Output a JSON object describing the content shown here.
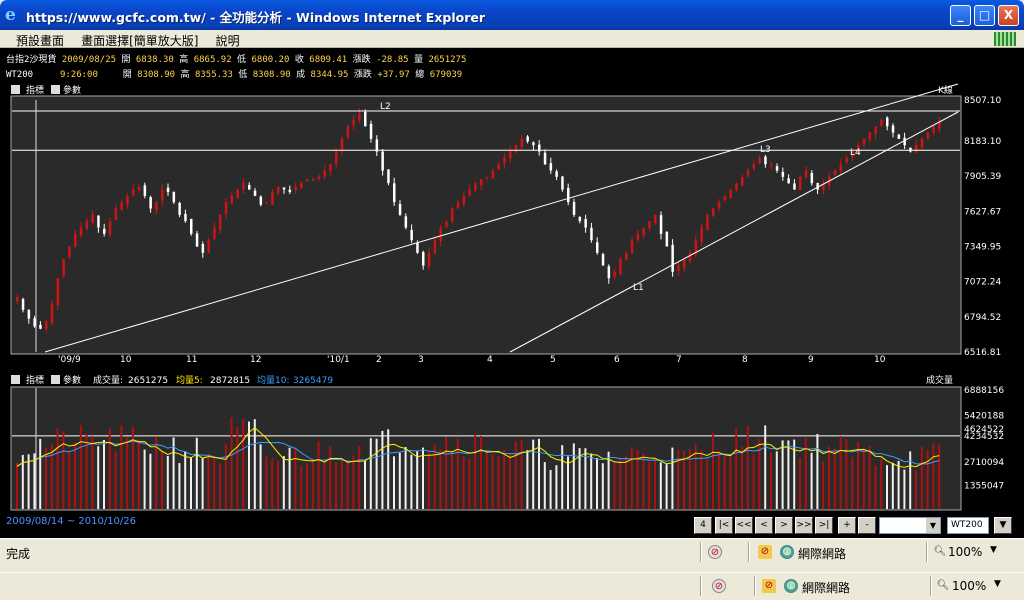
{
  "window": {
    "title": "https://www.gcfc.com.tw/ - 全功能分析 - Windows Internet Explorer",
    "btn_min": "_",
    "btn_max": "□",
    "btn_close": "X"
  },
  "menu": [
    "預設畫面",
    "畫面選擇[簡單放大版]",
    "說明"
  ],
  "quotes": [
    {
      "name": "台指2沙現貨",
      "date": "2009/08/25",
      "open_lbl": "開",
      "open": "6838.30",
      "high_lbl": "高",
      "high": "6865.92",
      "low_lbl": "低",
      "low": "6800.20",
      "close_lbl": "收",
      "close": "6809.41",
      "chg_lbl": "漲跌",
      "chg": "-28.85",
      "vol_lbl": "量",
      "vol": "2651275"
    },
    {
      "name": "WT200",
      "date": "9:26:00",
      "open_lbl": "開",
      "open": "8308.90",
      "high_lbl": "高",
      "high": "8355.33",
      "low_lbl": "低",
      "low": "8308.90",
      "close_lbl": "成",
      "close": "8344.95",
      "chg_lbl": "漲跌",
      "chg": "+37.97",
      "vol_lbl": "總",
      "vol": "679039"
    }
  ],
  "price_panel": {
    "indicator_btn": "指標",
    "param_btn": "參數",
    "kline_label": "K線",
    "labels": {
      "L1": "L1",
      "L2": "L2",
      "L3": "L3",
      "L4": "L4"
    }
  },
  "volume_panel": {
    "indicator_btn": "指標",
    "param_btn": "參數",
    "vol_title": "成交量:",
    "vol_value": "2651275",
    "ma5_label": "均量5:",
    "ma5_value": "2872815",
    "ma10_label": "均量10:",
    "ma10_value": "3265479",
    "right_label": "成交量"
  },
  "bottom": {
    "date_range": "2009/08/14 ~ 2010/10/26",
    "nav_buttons": [
      "4",
      "|<",
      "<<",
      "<",
      ">",
      ">>",
      ">|",
      "+",
      "-"
    ],
    "combo_value": "",
    "symbol_value": "WT200"
  },
  "status": {
    "left_text": "完成",
    "zone_text": "網際網路",
    "zoom_text": "100%"
  },
  "colors": {
    "up": "#d01414",
    "down": "#ffffff",
    "ma5": "#ffee00",
    "ma10": "#3aa0ff",
    "bg": "#000000",
    "grid": "#6a6a6a"
  },
  "chart_data": [
    {
      "type": "candlestick",
      "y_ticks": [
        8507.1,
        8183.1,
        7905.39,
        7627.67,
        7349.95,
        7072.24,
        6794.52,
        6516.81
      ],
      "ylim": [
        6516.81,
        8507.1
      ],
      "x_tick_labels": [
        "'09/9",
        "10",
        "11",
        "12",
        "'10/1",
        "2",
        "3",
        "4",
        "5",
        "6",
        "7",
        "8",
        "9",
        "10"
      ],
      "close_series": [
        6950,
        6850,
        6780,
        6720,
        6700,
        6760,
        6900,
        7100,
        7250,
        7350,
        7450,
        7500,
        7550,
        7600,
        7500,
        7450,
        7550,
        7650,
        7700,
        7750,
        7800,
        7820,
        7750,
        7650,
        7700,
        7800,
        7780,
        7700,
        7600,
        7550,
        7450,
        7350,
        7300,
        7400,
        7500,
        7600,
        7700,
        7750,
        7800,
        7850,
        7800,
        7750,
        7680,
        7700,
        7780,
        7820,
        7800,
        7780,
        7820,
        7850,
        7880,
        7880,
        7900,
        7950,
        8000,
        8100,
        8200,
        8300,
        8350,
        8400,
        8300,
        8200,
        8100,
        7950,
        7850,
        7700,
        7600,
        7500,
        7400,
        7300,
        7200,
        7300,
        7400,
        7500,
        7550,
        7650,
        7700,
        7750,
        7800,
        7850,
        7880,
        7900,
        7950,
        8000,
        8050,
        8100,
        8150,
        8200,
        8180,
        8150,
        8100,
        8000,
        7950,
        7900,
        7800,
        7700,
        7600,
        7550,
        7500,
        7400,
        7300,
        7200,
        7100,
        7150,
        7250,
        7300,
        7400,
        7450,
        7500,
        7550,
        7600,
        7450,
        7350,
        7150,
        7200,
        7250,
        7300,
        7400,
        7500,
        7600,
        7650,
        7700,
        7750,
        7800,
        7850,
        7900,
        7950,
        8000,
        8050,
        8000,
        8000,
        7950,
        7900,
        7850,
        7800,
        7900,
        7950,
        7850,
        7800,
        7850,
        7900,
        7950,
        8000,
        8050,
        8100,
        8150,
        8200,
        8250,
        8300,
        8350,
        8300,
        8250,
        8200,
        8150,
        8100,
        8150,
        8200,
        8250,
        8300,
        8350
      ],
      "lines": {
        "L1": [
          [
            7090,
            6
          ],
          [
            8390,
            156
          ]
        ],
        "L2": [
          [
            8420,
            0
          ],
          [
            8420,
            156
          ]
        ],
        "L3": [
          [
            6520,
            0
          ],
          [
            8507,
            156
          ]
        ],
        "L4": [
          [
            6516,
            50
          ],
          [
            8430,
            156
          ]
        ],
        "H1": [
          [
            8110,
            0
          ],
          [
            8110,
            156
          ]
        ]
      }
    },
    {
      "type": "bar",
      "y_ticks": [
        6888156,
        5420188,
        4624522,
        4234532,
        2710094,
        1355047
      ],
      "ylim": [
        0,
        6888156
      ],
      "series": [
        {
          "name": "成交量",
          "type": "bar"
        },
        {
          "name": "均量5",
          "type": "line"
        },
        {
          "name": "均量10",
          "type": "line"
        }
      ]
    }
  ]
}
